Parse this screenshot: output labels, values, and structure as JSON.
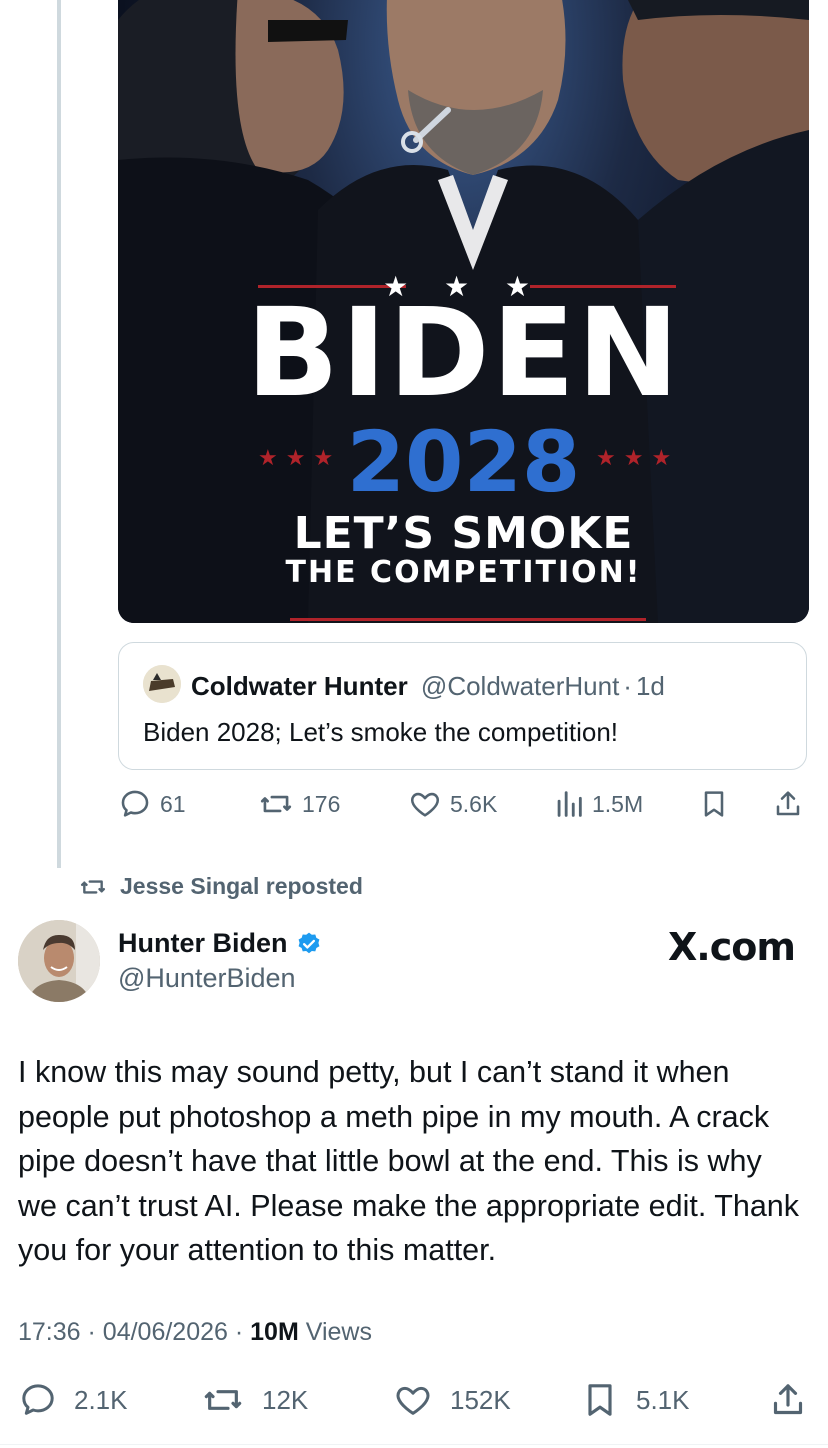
{
  "colors": {
    "accent": "#1d9bf0",
    "secondary_text": "#536471",
    "poster_red": "#b0232a",
    "poster_blue": "#2f6fd0"
  },
  "poster": {
    "stars": "★ ★ ★",
    "title": "BIDEN",
    "year": "2028",
    "side_stars": "★★★",
    "slogan_line1": "LET’S SMOKE",
    "slogan_line2": "THE COMPETITION!"
  },
  "quoted_tweet": {
    "author_name": "Coldwater Hunter",
    "author_handle": "@ColdwaterHunt",
    "separator": "·",
    "time": "1d",
    "text": "Biden 2028; Let’s smoke the competition!"
  },
  "quote_actions": {
    "replies": "61",
    "reposts": "176",
    "likes": "5.6K",
    "views": "1.5M"
  },
  "repost_banner": "Jesse Singal reposted",
  "tweet": {
    "author_name": "Hunter Biden",
    "author_handle": "@HunterBiden",
    "watermark": "X.com",
    "text": "I know this may sound petty, but I can’t stand it when people put photoshop a meth pipe in my mouth. A crack pipe doesn’t have that little bowl at the end. This is why we can’t trust AI. Please make the appropriate edit. Thank you for your attention to this matter.",
    "time": "17:36",
    "dot": "·",
    "date": "04/06/2026",
    "views_count": "10M",
    "views_label": "Views"
  },
  "tweet_actions": {
    "replies": "2.1K",
    "reposts": "12K",
    "likes": "152K",
    "bookmarks": "5.1K"
  },
  "icons": [
    "reply-icon",
    "repost-icon",
    "like-icon",
    "views-icon",
    "bookmark-icon",
    "share-icon",
    "verified-badge-icon"
  ]
}
